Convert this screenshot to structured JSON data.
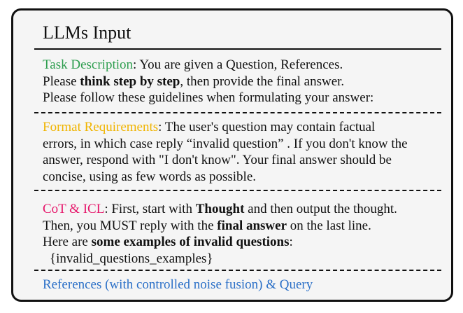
{
  "title": "LLMs Input",
  "task": {
    "label": "Task Description",
    "line1_rest": ": You are given a Question, References.",
    "line2_a": "Please ",
    "line2_bold": "think step by step",
    "line2_b": ", then provide the final answer.",
    "line3": "Please follow these guidelines when formulating your answer:"
  },
  "format": {
    "label": "Format Requirements",
    "line1_rest": ": The user's question may contain factual",
    "line2": "errors, in which case reply “invalid question” . If you don't know the",
    "line3": "answer, respond with \"I don't know\". Your final answer should be",
    "line4": "concise, using as few words as possible."
  },
  "cot": {
    "label": "CoT & ICL",
    "line1_a": ": First, start with ",
    "line1_bold": "Thought",
    "line1_b": " and then output the thought.",
    "line2_a": "Then, you MUST reply with the ",
    "line2_bold": "final answer",
    "line2_b": " on the last line.",
    "line3_a": "Here are ",
    "line3_bold": "some examples of invalid questions",
    "line3_b": ":",
    "line4": "{invalid_questions_examples}"
  },
  "footer": "References (with controlled noise fusion) & Query",
  "colors": {
    "task_label": "#2e9e4f",
    "format_label": "#f0b400",
    "cot_label": "#e6166a",
    "footer": "#2a6fc7",
    "panel_bg": "#f5f5f5",
    "border": "#111111"
  }
}
